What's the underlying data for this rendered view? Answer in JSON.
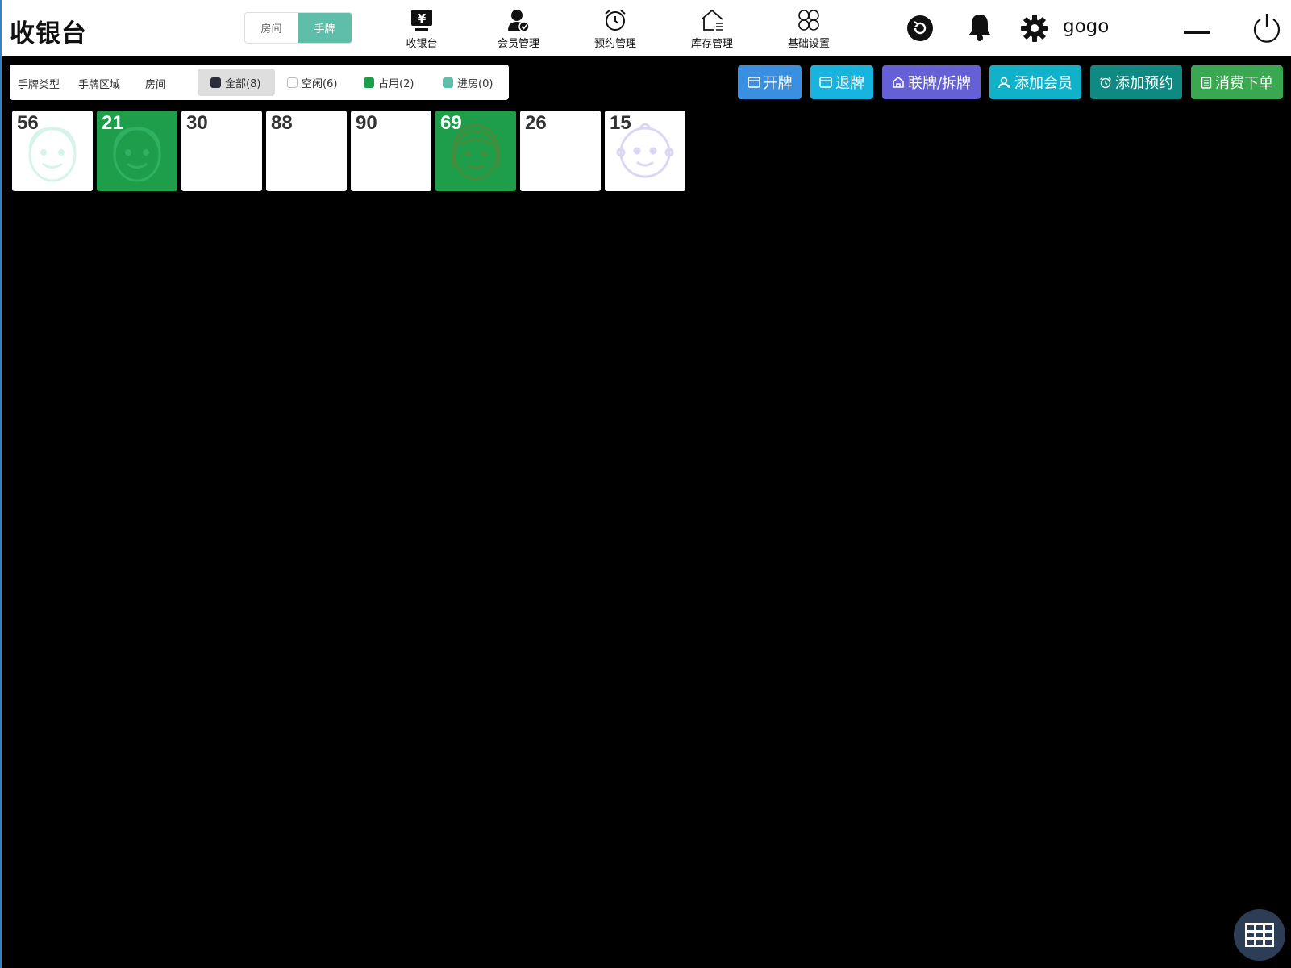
{
  "app": {
    "title": "收银台",
    "username": "gogo"
  },
  "view_toggle": {
    "room": "房间",
    "tag": "手牌"
  },
  "nav": [
    {
      "label": "收银台",
      "icon": "cashier-icon"
    },
    {
      "label": "会员管理",
      "icon": "member-icon"
    },
    {
      "label": "预约管理",
      "icon": "alarm-clock-icon"
    },
    {
      "label": "库存管理",
      "icon": "warehouse-icon"
    },
    {
      "label": "基础设置",
      "icon": "settings-grid-icon"
    }
  ],
  "filters": {
    "type": "手牌类型",
    "area": "手牌区域",
    "room": "房间",
    "all": "全部(8)",
    "idle": "空闲(6)",
    "occupied": "占用(2)",
    "checked_in": "进房(0)"
  },
  "colors": {
    "all": "#2a2d3e",
    "occupied": "#1e9e4a",
    "checked_in": "#5fbea9",
    "accent": "#5fbea9"
  },
  "actions": {
    "open": "开牌",
    "return": "退牌",
    "link": "联牌/拆牌",
    "add_member": "添加会员",
    "add_reservation": "添加预约",
    "order": "消费下单"
  },
  "cards": [
    {
      "number": "56",
      "status": "idle",
      "icon": "man-face-icon"
    },
    {
      "number": "21",
      "status": "occupied",
      "icon": "man-face-icon"
    },
    {
      "number": "30",
      "status": "idle",
      "icon": ""
    },
    {
      "number": "88",
      "status": "idle",
      "icon": ""
    },
    {
      "number": "90",
      "status": "idle",
      "icon": ""
    },
    {
      "number": "69",
      "status": "occupied",
      "icon": "woman-face-icon"
    },
    {
      "number": "26",
      "status": "idle",
      "icon": ""
    },
    {
      "number": "15",
      "status": "idle",
      "icon": "baby-face-icon"
    }
  ]
}
